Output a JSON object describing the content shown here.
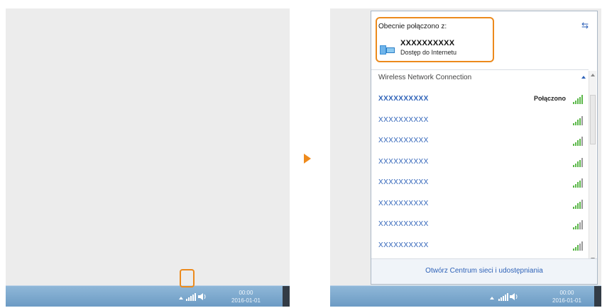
{
  "left_screen": {
    "clock": {
      "time": "00:00",
      "date": "2016-01-01"
    }
  },
  "right_screen": {
    "clock": {
      "time": "00:00",
      "date": "2016-01-01"
    }
  },
  "popup": {
    "current_label": "Obecnie połączono z:",
    "current_network": {
      "name": "XXXXXXXXXX",
      "status": "Dostęp do Internetu"
    },
    "refresh_icon": "refresh-icon",
    "section_header": "Wireless Network Connection",
    "networks": [
      {
        "name": "XXXXXXXXXX",
        "status": "Połączono",
        "signal_bars": 5
      },
      {
        "name": "XXXXXXXXXX",
        "signal_bars": 4
      },
      {
        "name": "XXXXXXXXXX",
        "signal_bars": 4
      },
      {
        "name": "XXXXXXXXXX",
        "signal_bars": 4
      },
      {
        "name": "XXXXXXXXXX",
        "signal_bars": 4
      },
      {
        "name": "XXXXXXXXXX",
        "signal_bars": 4
      },
      {
        "name": "XXXXXXXXXX",
        "signal_bars": 3
      },
      {
        "name": "XXXXXXXXXX",
        "signal_bars": 3
      }
    ],
    "footer_link": "Otwórz Centrum sieci i udostępniania"
  },
  "colors": {
    "highlight": "#ec8a1c",
    "link": "#2e62b8",
    "signal": "#5cb84a",
    "taskbar": "#7eabd0"
  }
}
